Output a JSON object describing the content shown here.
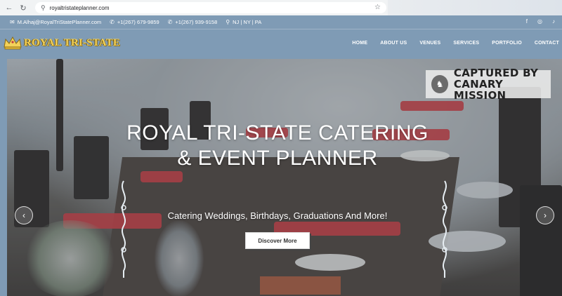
{
  "browser": {
    "url": "royaltristateplanner.com",
    "icons": [
      "back-icon",
      "reload-icon",
      "home-icon",
      "site-settings-icon",
      "star-icon"
    ]
  },
  "infobar": {
    "email": "M.Alhaj@RoyalTriStatePlanner.com",
    "phone1": "+1(267) 679-9859",
    "phone2": "+1(267) 939-9158",
    "location": "NJ | NY | PA",
    "social": [
      "facebook-icon",
      "instagram-icon",
      "tiktok-icon"
    ]
  },
  "header": {
    "logo_text": "ROYAL TRI-STATE",
    "menu": [
      "HOME",
      "ABOUT US",
      "VENUES",
      "SERVICES",
      "PORTFOLIO",
      "CONTACT"
    ]
  },
  "hero": {
    "title_line1": "ROYAL TRI-STATE CATERING",
    "title_line2": "& EVENT PLANNER",
    "subtitle": "Catering Weddings, Birthdays, Graduations And More!",
    "button": "Discover More"
  },
  "watermark": {
    "line1": "CAPTURED BY",
    "line2": "CANARY MISSION"
  },
  "colors": {
    "brand_bar": "#7f9bb5",
    "logo_gold": "#f3d25a",
    "napkin_red": "#c83a3f"
  }
}
